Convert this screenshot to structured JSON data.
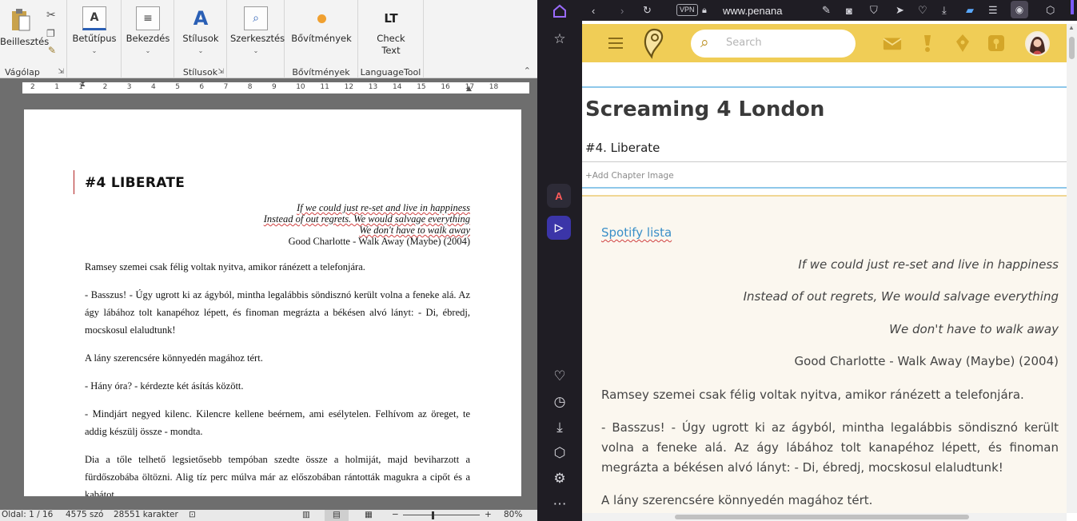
{
  "word": {
    "ribbon": {
      "paste_label": "Beillesztés",
      "clipboard_label": "Vágólap",
      "font_label": "Betűtípus",
      "paragraph_label": "Bekezdés",
      "styles_button": "Stílusok",
      "styles_group": "Stílusok",
      "editing_label": "Szerkesztés",
      "addins_button": "Bővítmények",
      "addins_group": "Bővítmények",
      "check_text_line1": "Check",
      "check_text_line2": "Text",
      "languagetool_group": "LanguageTool"
    },
    "ruler_ticks": [
      "2",
      "1",
      "1",
      "2",
      "3",
      "4",
      "5",
      "6",
      "7",
      "8",
      "9",
      "10",
      "11",
      "12",
      "13",
      "14",
      "15",
      "16",
      "17",
      "18"
    ],
    "document": {
      "heading": "#4 LIBERATE",
      "quote_lines": [
        "If we could just re-set and live in happiness",
        "Instead of out regrets. We would salvage everything",
        "We don't have to walk away"
      ],
      "quote_source": "Good Charlotte - Walk Away (Maybe) (2004)",
      "paragraphs": [
        "Ramsey szemei csak félig voltak nyitva, amikor ránézett a telefonjára.",
        "- Basszus! - Úgy ugrott ki az ágyból, mintha legalábbis söndisznó került volna a feneke alá. Az ágy lábához tolt kanapéhoz lépett, és finoman megrázta a békésen alvó lányt: - Di, ébredj, mocskosul elaludtunk!",
        "A lány szerencsére könnyedén magához tért.",
        "- Hány óra? - kérdezte két ásítás között.",
        "- Mindjárt negyed kilenc. Kilencre kellene beérnem, ami esélytelen. Felhívom az öreget, te addig készülj össze - mondta.",
        "Dia a tőle telhető legsietősebb tempóban szedte össze a holmiját, majd beviharzott a fürdőszobába öltözni. Alig tíz perc múlva már az előszobában rántották magukra a cipőt és a kabátot."
      ]
    },
    "status": {
      "page": "Oldal: 1 / 16",
      "words": "4575 szó",
      "chars": "28551 karakter",
      "zoom": "80%"
    }
  },
  "browser": {
    "url": "www.penana",
    "vpn_label": "VPN",
    "search_placeholder": "Search",
    "story_title": "Screaming 4 London",
    "chapter_title": "#4. Liberate",
    "add_chapter_image": "+Add Chapter Image",
    "spotify_link": "Spotify lista",
    "quote_lines": [
      "If we could just re-set and live in happiness",
      "Instead of out regrets, We would salvage everything",
      "We don't have to walk away"
    ],
    "quote_source": "Good Charlotte - Walk Away (Maybe) (2004)",
    "paragraphs": [
      "Ramsey szemei csak félig voltak nyitva, amikor ránézett a telefonjára.",
      "- Basszus! - Úgy ugrott ki az ágyból, mintha legalábbis söndisznó került volna a feneke alá. Az ágy lábához tolt kanapéhoz lépett, és finoman megrázta a békésen alvó lányt: - Di, ébredj, mocskosul elaludtunk!",
      "A lány szerencsére könnyedén magához tért."
    ],
    "colors": {
      "header": "#f0cd56",
      "accent": "#3a8fc8",
      "reading_bg": "#fbf7ef"
    }
  }
}
